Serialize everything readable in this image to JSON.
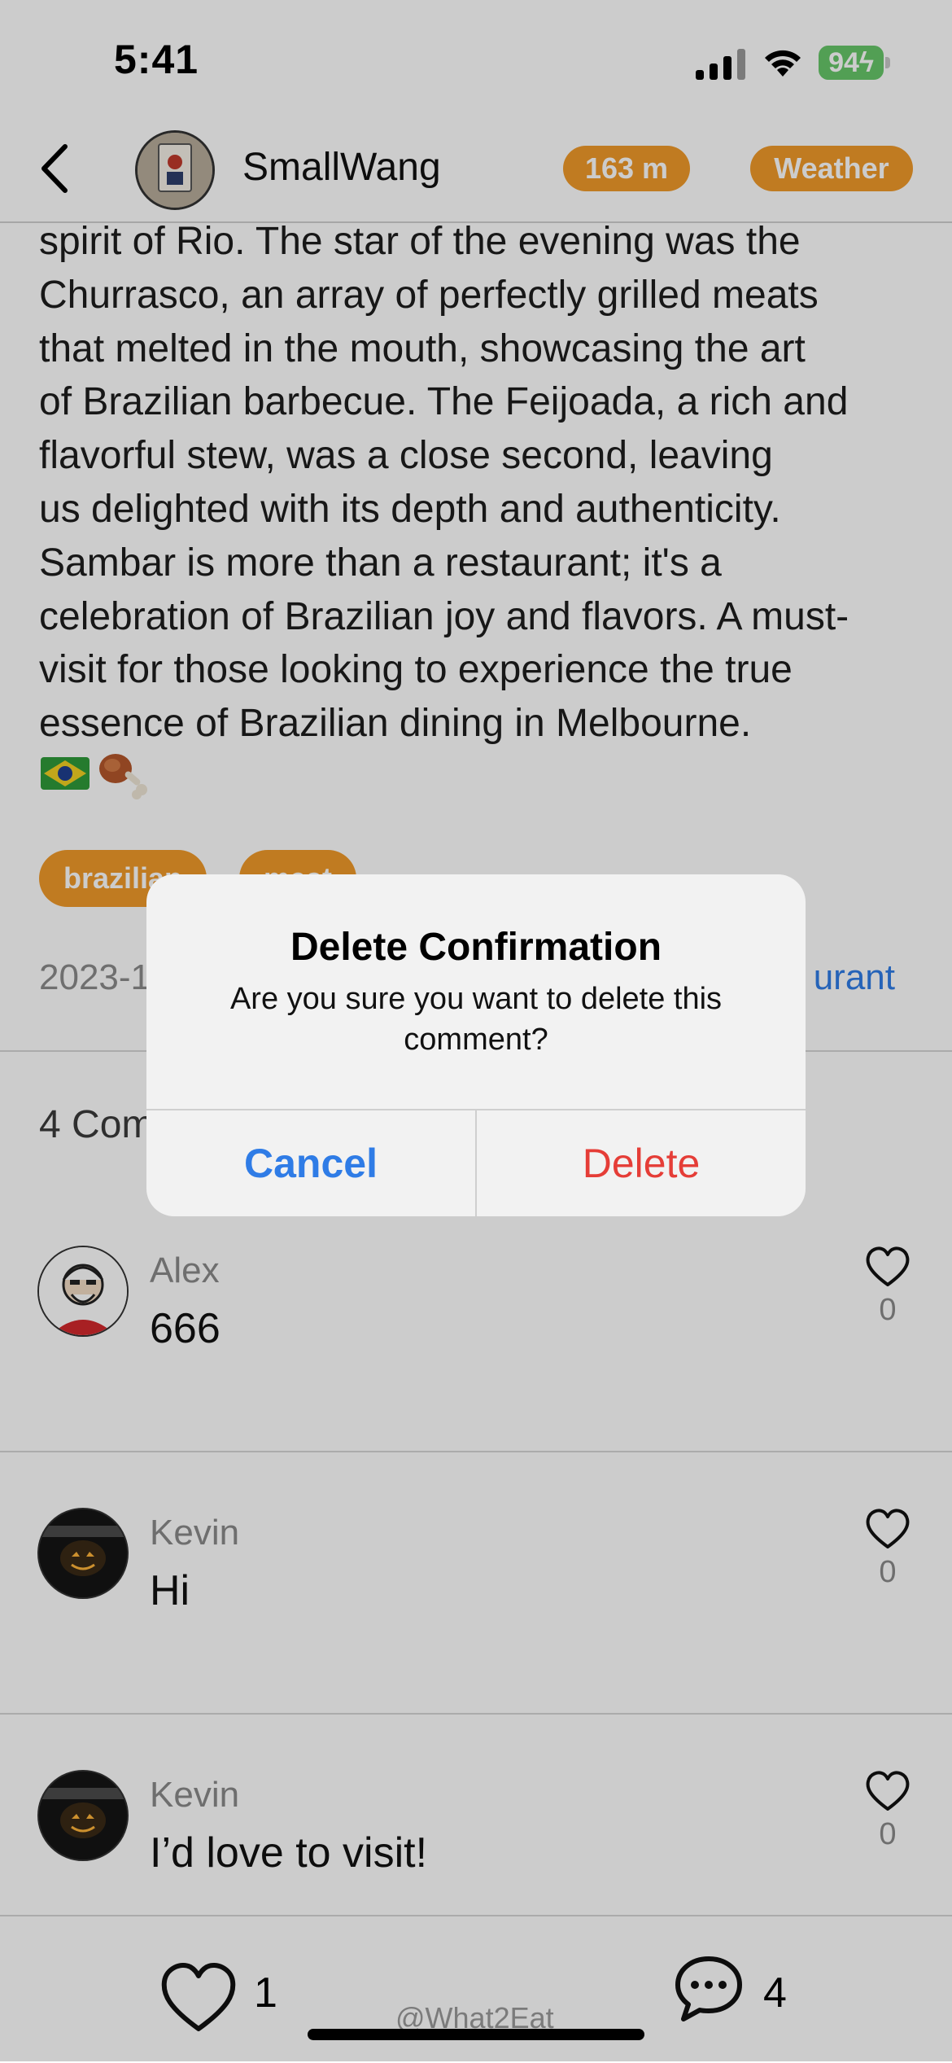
{
  "status_bar": {
    "time": "5:41",
    "battery": "94"
  },
  "header": {
    "username": "SmallWang",
    "distance": "163 m",
    "weather": "Weather"
  },
  "post": {
    "text": "spirit of Rio. The star of the evening was the\nChurrasco, an array of perfectly grilled meats\nthat melted in the mouth, showcasing the art\nof Brazilian barbecue. The Feijoada, a rich and\nflavorful stew, was a close second, leaving\nus delighted with its depth and authenticity.\nSambar is more than a restaurant; it's a\ncelebration of Brazilian joy and flavors. A must-\nvisit for those looking to experience the true\nessence of Brazilian dining in Melbourne.",
    "tags": [
      "brazilian",
      "meat"
    ],
    "date": "2023-1",
    "place": "urant"
  },
  "comments_header": "4 Com",
  "comments": [
    {
      "name": "Alex",
      "text": "666",
      "likes": "0"
    },
    {
      "name": "Kevin",
      "text": "Hi",
      "likes": "0"
    },
    {
      "name": "Kevin",
      "text": "I’d love to visit!",
      "likes": "0"
    }
  ],
  "bottom_bar": {
    "likes": "1",
    "comments": "4",
    "watermark": "@What2Eat"
  },
  "dialog": {
    "title": "Delete Confirmation",
    "message": "Are you sure you want to delete this comment?",
    "cancel_label": "Cancel",
    "delete_label": "Delete"
  },
  "colors": {
    "accent": "#f09a2a",
    "link": "#2f7ce6",
    "destructive": "#e53d37"
  }
}
